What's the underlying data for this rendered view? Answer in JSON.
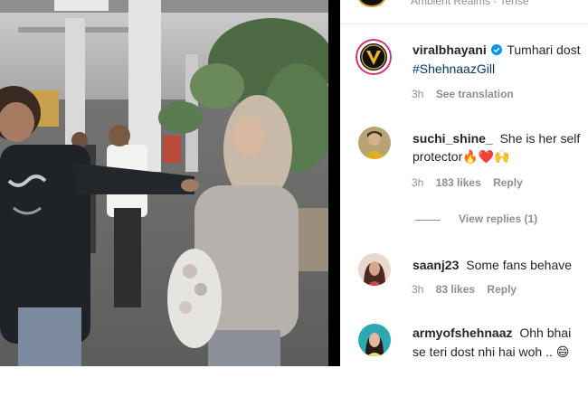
{
  "top_cut": {
    "text": "Ambient Realms · Tense"
  },
  "caption": {
    "username": "viralbhayani",
    "text": "Tumhari dost",
    "hashtag": "#ShehnaazGill",
    "time": "3h",
    "see_translation": "See translation"
  },
  "comments": [
    {
      "username": "suchi_shine_",
      "line1": "She is her self",
      "line2": "protector",
      "emojis": "🔥❤️🙌",
      "time": "3h",
      "likes": "183 likes",
      "reply": "Reply"
    },
    {
      "username": "saanj23",
      "line1": "Some fans behave",
      "time": "3h",
      "likes": "83 likes",
      "reply": "Reply"
    },
    {
      "username": "armyofshehnaaz",
      "line1": "Ohh bhai",
      "line2": "se teri dost nhi hai woh ..",
      "emojis": "😄"
    }
  ],
  "view_replies": "View replies (1)",
  "colors": {
    "link": "#00376b",
    "meta": "#8e8e8e",
    "verified": "#0095f6",
    "text": "#262626"
  }
}
